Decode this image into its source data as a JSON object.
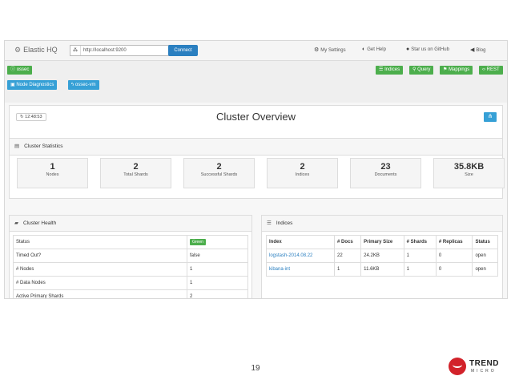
{
  "navbar": {
    "brand": "Elastic HQ",
    "url_value": "http://localhost:9200",
    "connect_label": "Connect",
    "links": [
      "My Settings",
      "Get Help",
      "Star us on GitHub",
      "Blog"
    ]
  },
  "cluster_button": "ossec",
  "node_buttons": [
    "Node Diagnostics",
    "ossec-vm"
  ],
  "right_buttons": [
    "Indices",
    "Query",
    "Mappings",
    "REST"
  ],
  "overview": {
    "time": "12:48:53",
    "title": "Cluster Overview"
  },
  "stats": {
    "header": "Cluster Statistics",
    "items": [
      {
        "value": "1",
        "label": "Nodes"
      },
      {
        "value": "2",
        "label": "Total Shards"
      },
      {
        "value": "2",
        "label": "Successful Shards"
      },
      {
        "value": "2",
        "label": "Indices"
      },
      {
        "value": "23",
        "label": "Documents"
      },
      {
        "value": "35.8KB",
        "label": "Size"
      }
    ]
  },
  "health": {
    "header": "Cluster Health",
    "rows": [
      {
        "label": "Status",
        "value": "Green"
      },
      {
        "label": "Timed Out?",
        "value": "false"
      },
      {
        "label": "# Nodes",
        "value": "1"
      },
      {
        "label": "# Data Nodes",
        "value": "1"
      },
      {
        "label": "Active Primary Shards",
        "value": "2"
      }
    ]
  },
  "indices": {
    "header": "Indices",
    "columns": [
      "Index",
      "# Docs",
      "Primary Size",
      "# Shards",
      "# Replicas",
      "Status"
    ],
    "rows": [
      [
        "logstash-2014.08.22",
        "22",
        "24.2KB",
        "1",
        "0",
        "open"
      ],
      [
        "kibana-int",
        "1",
        "11.6KB",
        "1",
        "0",
        "open"
      ]
    ]
  },
  "page_number": "19",
  "logo": {
    "name": "TREND",
    "sub": "MICRO"
  }
}
